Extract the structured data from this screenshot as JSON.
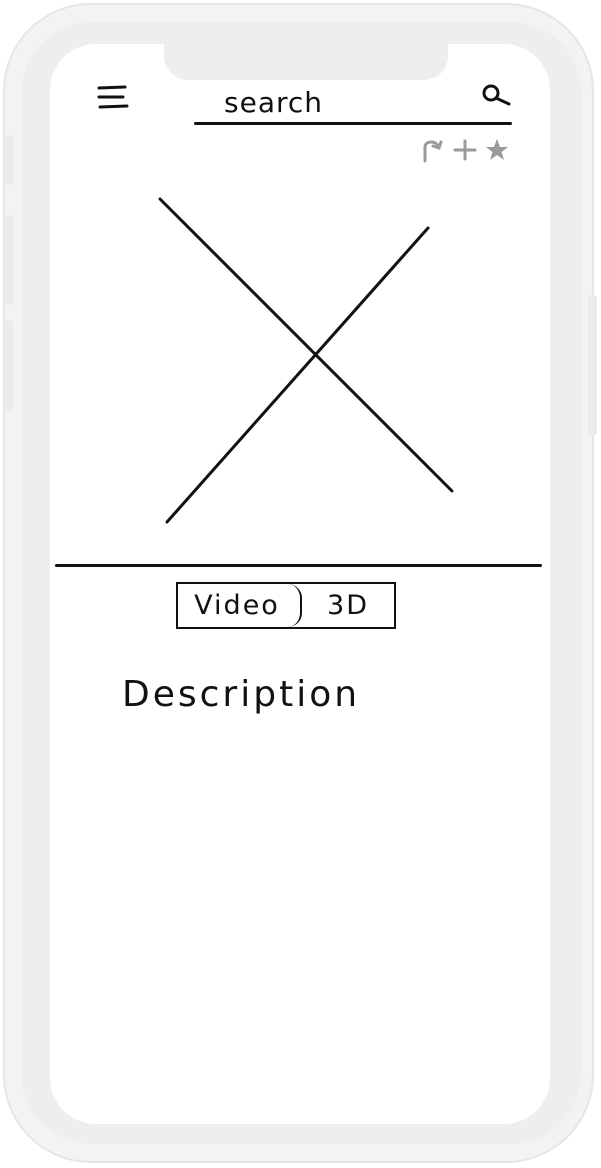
{
  "header": {
    "menu_icon": "hamburger-icon",
    "search": {
      "placeholder": "search",
      "value": "",
      "icon": "search-icon"
    },
    "actions": [
      {
        "icon": "share-icon"
      },
      {
        "icon": "add-icon"
      },
      {
        "icon": "star-icon"
      }
    ],
    "action_color": "#9a9a9a"
  },
  "media": {
    "placeholder_icon": "image-placeholder-icon"
  },
  "tabs": {
    "items": [
      {
        "label": "Video"
      },
      {
        "label": "3D"
      }
    ]
  },
  "content": {
    "description": "Description"
  },
  "colors": {
    "ink": "#111111",
    "frame": "#eeeef1"
  }
}
